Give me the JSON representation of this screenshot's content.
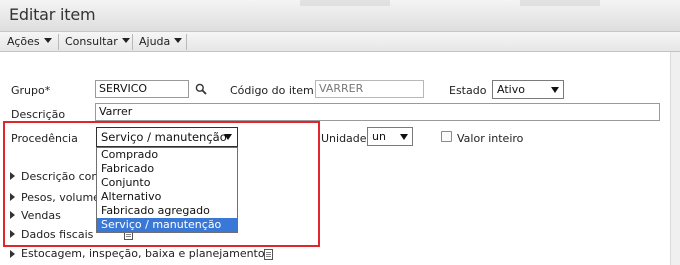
{
  "window": {
    "title": "Editar item"
  },
  "menubar": {
    "items": [
      {
        "label": "Ações"
      },
      {
        "label": "Consultar"
      },
      {
        "label": "Ajuda"
      }
    ]
  },
  "form": {
    "grupo": {
      "label": "Grupo*",
      "value": "SERVICO"
    },
    "codigo": {
      "label": "Código do item",
      "value": "VARRER"
    },
    "estado": {
      "label": "Estado",
      "value": "Ativo"
    },
    "descricao": {
      "label": "Descrição",
      "value": "Varrer"
    },
    "procedencia": {
      "label": "Procedência",
      "value": "Serviço / manutenção",
      "options": [
        "Comprado",
        "Fabricado",
        "Conjunto",
        "Alternativo",
        "Fabricado agregado",
        "Serviço / manutenção"
      ],
      "selected_index": 5
    },
    "unidade": {
      "label": "Unidade",
      "value": "un"
    },
    "valor_inteiro": {
      "label": "Valor inteiro",
      "checked": false
    }
  },
  "sections": [
    {
      "label": "Descrição com"
    },
    {
      "label": "Pesos, volume"
    },
    {
      "label": "Vendas"
    },
    {
      "label": "Dados fiscais"
    },
    {
      "label": "Estocagem, inspeção, baixa e planejamento"
    }
  ],
  "colors": {
    "highlight": "#e0262c",
    "selected_option": "#3a78d8"
  }
}
